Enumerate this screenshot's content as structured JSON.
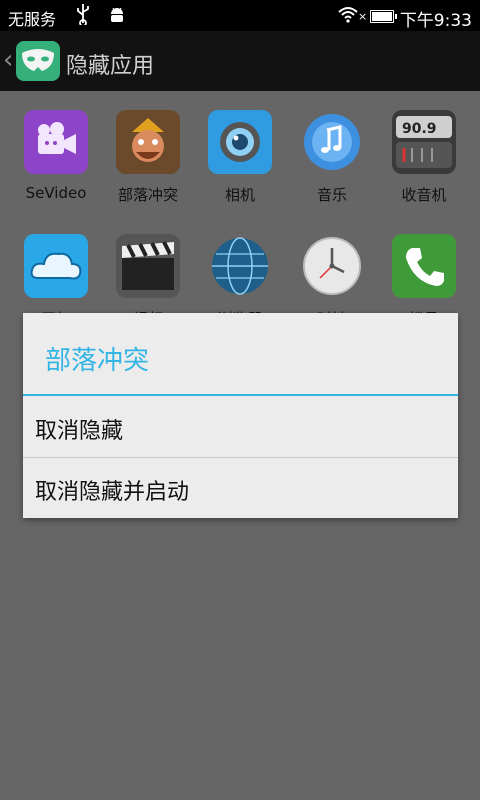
{
  "status_bar": {
    "carrier": "无服务",
    "time": "下午9:33",
    "signal_x": "×"
  },
  "header": {
    "back_glyph": "‹",
    "title": "隐藏应用"
  },
  "apps": [
    {
      "label": "SeVideo",
      "icon": "sevideo-icon",
      "color": "#8e44c8"
    },
    {
      "label": "部落冲突",
      "icon": "clash-of-clans-icon",
      "color": "#e0a020"
    },
    {
      "label": "相机",
      "icon": "camera-icon",
      "color": "#2f9be0"
    },
    {
      "label": "音乐",
      "icon": "music-icon",
      "color": "#3d8fe0"
    },
    {
      "label": "收音机",
      "icon": "radio-icon",
      "color": "#4a4a4a"
    },
    {
      "label": "天气",
      "icon": "weather-icon",
      "color": "#2aa7e6"
    },
    {
      "label": "视频",
      "icon": "video-icon",
      "color": "#222222"
    },
    {
      "label": "浏览器",
      "icon": "browser-icon",
      "color": "#1d5f8a"
    },
    {
      "label": "时钟",
      "icon": "clock-icon",
      "color": "#e8e8e8"
    },
    {
      "label": "拨号",
      "icon": "dialer-icon",
      "color": "#3f9a3a"
    }
  ],
  "radio_freq": "90.9",
  "dialog": {
    "title": "部落冲突",
    "items": [
      {
        "label": "取消隐藏"
      },
      {
        "label": "取消隐藏并启动"
      }
    ],
    "accent": "#33b5e5"
  }
}
